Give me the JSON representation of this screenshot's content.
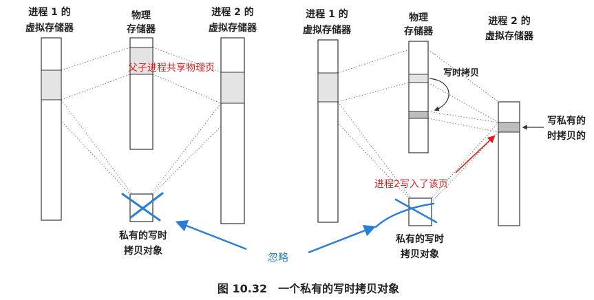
{
  "left": {
    "proc1_label": [
      "进程 1 的",
      "虚拟存储器"
    ],
    "phys_label": [
      "物理",
      "存储器"
    ],
    "proc2_label": [
      "进程 2 的",
      "虚拟存储器"
    ],
    "shared_note": "父子进程共享物理页",
    "private_obj_label": [
      "私有的写时",
      "拷贝对象"
    ]
  },
  "right": {
    "proc1_label": [
      "进程 1 的",
      "虚拟存储器"
    ],
    "phys_label": [
      "物理",
      "存储器"
    ],
    "proc2_label": [
      "进程 2 的",
      "虚拟存储器"
    ],
    "copy_note": "写时拷贝",
    "private_page_label": [
      "写私有的",
      "时拷贝的"
    ],
    "write_note": "进程2写入了该页",
    "private_obj_label": [
      "私有的写时",
      "拷贝对象"
    ]
  },
  "ignore_label": "忽略",
  "caption": "图 10.32　一个私有的写时拷贝对象",
  "colors": {
    "annotation_red": "#e02020",
    "annotation_blue": "#2a7fd4"
  }
}
